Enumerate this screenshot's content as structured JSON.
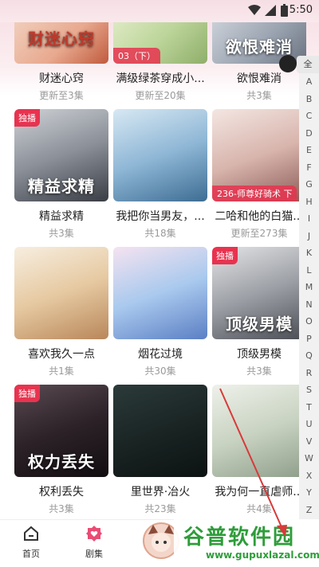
{
  "status": {
    "time": "5:50"
  },
  "index": {
    "toggle": "全",
    "fab": "",
    "letters": [
      "A",
      "B",
      "C",
      "D",
      "E",
      "F",
      "G",
      "H",
      "I",
      "J",
      "K",
      "L",
      "M",
      "N",
      "O",
      "P",
      "Q",
      "R",
      "S",
      "T",
      "U",
      "V",
      "W",
      "X",
      "Y",
      "Z"
    ]
  },
  "rows": [
    {
      "items": [
        {
          "title": "财迷心窍",
          "sub": "更新至3集",
          "cover_text": "财迷心窍",
          "badge_ep": "",
          "exclusive": ""
        },
        {
          "title": "满级绿茶穿成小...",
          "sub": "更新至20集",
          "cover_text": "",
          "badge_ep": "03（下）",
          "exclusive": ""
        },
        {
          "title": "欲恨难消",
          "sub": "共3集",
          "cover_text": "欲恨难消",
          "badge_ep": "",
          "exclusive": ""
        }
      ]
    },
    {
      "items": [
        {
          "title": "精益求精",
          "sub": "共3集",
          "cover_text": "精益求精",
          "badge_ep": "",
          "exclusive": "独播"
        },
        {
          "title": "我把你当男友，...",
          "sub": "共18集",
          "cover_text": "",
          "badge_ep": "",
          "exclusive": ""
        },
        {
          "title": "二哈和他的白猫...",
          "sub": "更新至273集",
          "cover_text": "",
          "badge_ep": "236-师尊好骑术 下",
          "exclusive": ""
        }
      ]
    },
    {
      "items": [
        {
          "title": "喜欢我久一点",
          "sub": "共1集",
          "cover_text": "",
          "badge_ep": "",
          "exclusive": ""
        },
        {
          "title": "烟花过境",
          "sub": "共30集",
          "cover_text": "",
          "badge_ep": "",
          "exclusive": ""
        },
        {
          "title": "顶级男模",
          "sub": "共3集",
          "cover_text": "顶级男模",
          "badge_ep": "",
          "exclusive": "独播"
        }
      ]
    },
    {
      "items": [
        {
          "title": "权利丢失",
          "sub": "共3集",
          "cover_text": "权力丢失",
          "badge_ep": "",
          "exclusive": "独播"
        },
        {
          "title": "里世界·冶火",
          "sub": "共23集",
          "cover_text": "",
          "badge_ep": "",
          "exclusive": ""
        },
        {
          "title": "我为何一直虐师...",
          "sub": "共4集",
          "cover_text": "",
          "badge_ep": "",
          "exclusive": ""
        }
      ]
    }
  ],
  "tabs": [
    {
      "label": "首页",
      "icon": "home-icon"
    },
    {
      "label": "剧集",
      "icon": "heart-badge-icon",
      "active": true
    },
    {
      "label": "",
      "icon": "avatar"
    }
  ],
  "watermark": {
    "main": "谷普软件园",
    "url": "www.gupuxlazal.com"
  },
  "colors": {
    "accent": "#e8334f",
    "watermark": "#2e9d3a",
    "header_bg": "#f6dde3"
  }
}
